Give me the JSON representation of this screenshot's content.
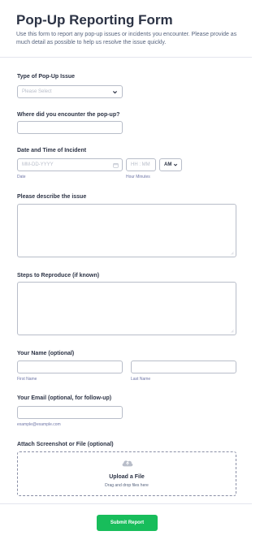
{
  "form": {
    "title": "Pop-Up Reporting Form",
    "description": "Use this form to report any pop-up issues or incidents you encounter. Please provide as much detail as possible to help us resolve the issue quickly."
  },
  "fields": {
    "issue_type": {
      "label": "Type of Pop-Up Issue",
      "placeholder": "Please Select"
    },
    "location": {
      "label": "Where did you encounter the pop-up?"
    },
    "datetime": {
      "label": "Date and Time of Incident",
      "date_placeholder": "MM-DD-YYYY",
      "date_sublabel": "Date",
      "time_placeholder": "HH : MM",
      "time_sublabel": "Hour Minutes",
      "ampm_value": "AM"
    },
    "description": {
      "label": "Please describe the issue"
    },
    "steps": {
      "label": "Steps to Reproduce (if known)"
    },
    "name": {
      "label": "Your Name (optional)",
      "first_sublabel": "First Name",
      "last_sublabel": "Last Name"
    },
    "email": {
      "label": "Your Email (optional, for follow-up)",
      "sublabel": "example@example.com"
    },
    "attachment": {
      "label": "Attach Screenshot or File (optional)",
      "upload_title": "Upload a File",
      "upload_hint": "Drag and drop files here"
    }
  },
  "submit": {
    "label": "Submit Report",
    "color": "#18bd5b"
  },
  "icons": {
    "select_caret": "chevron-down-icon",
    "date": "calendar-icon",
    "upload": "cloud-upload-icon"
  }
}
